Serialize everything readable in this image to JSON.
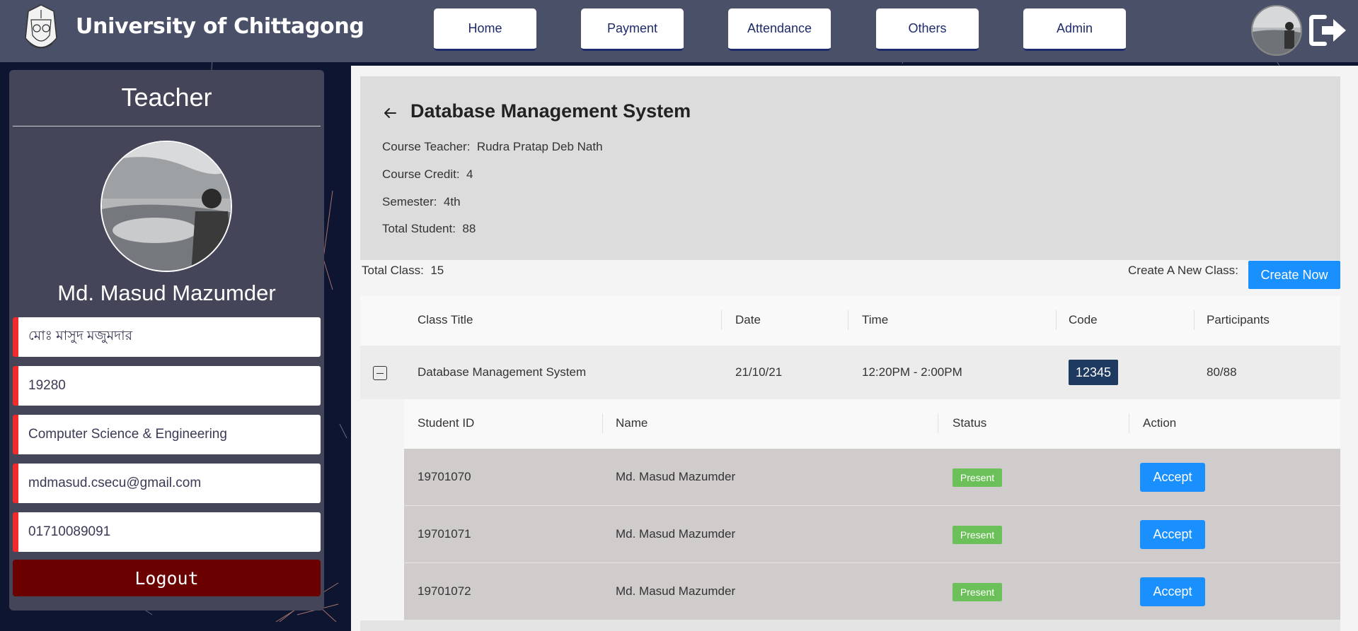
{
  "header": {
    "site_title": "University of Chittagong",
    "nav": [
      {
        "label": "Home"
      },
      {
        "label": "Payment"
      },
      {
        "label": "Attendance"
      },
      {
        "label": "Others"
      },
      {
        "label": "Admin"
      }
    ],
    "icons": {
      "logo": "university-seal-icon",
      "avatar": "user-avatar",
      "logout": "sign-out-icon"
    }
  },
  "sidebar": {
    "title": "Teacher",
    "name": "Md. Masud Mazumder",
    "fields": [
      "মোঃ মাসুদ মজুমদার",
      "19280",
      "Computer Science & Engineering",
      "mdmasud.csecu@gmail.com",
      "01710089091"
    ],
    "logout_label": "Logout"
  },
  "course": {
    "title": "Database Management System",
    "teacher_label": "Course Teacher",
    "teacher": "Rudra Pratap Deb Nath",
    "credit_label": "Course Credit",
    "credit": "4",
    "semester_label": "Semester",
    "semester": "4th",
    "students_label": "Total Student",
    "students": "88"
  },
  "classes": {
    "total_label": "Total Class",
    "total": "15",
    "create_label": "Create A New Class",
    "create_button": "Create Now",
    "columns": [
      "Class Title",
      "Date",
      "Time",
      "Code",
      "Participants"
    ],
    "rows": [
      {
        "title": "Database Management System",
        "date": "21/10/21",
        "time": "12:20PM - 2:00PM",
        "code": "12345",
        "participants": "80/88"
      }
    ]
  },
  "attendance": {
    "columns": [
      "Student ID",
      "Name",
      "Status",
      "Action"
    ],
    "rows": [
      {
        "id": "19701070",
        "name": "Md. Masud Mazumder",
        "status": "Present",
        "action": "Accept"
      },
      {
        "id": "19701071",
        "name": "Md. Masud Mazumder",
        "status": "Present",
        "action": "Accept"
      },
      {
        "id": "19701072",
        "name": "Md. Masud Mazumder",
        "status": "Present",
        "action": "Accept"
      }
    ]
  },
  "colors": {
    "header_bg": "#4a5068",
    "page_bg": "#0e1530",
    "sidebar_bg": "#454559",
    "accent_blue": "#1a90ff",
    "status_green": "#6cc05a",
    "logout_red": "#6b0000",
    "field_border": "#ef2b2b",
    "code_badge": "#1e3a61"
  }
}
